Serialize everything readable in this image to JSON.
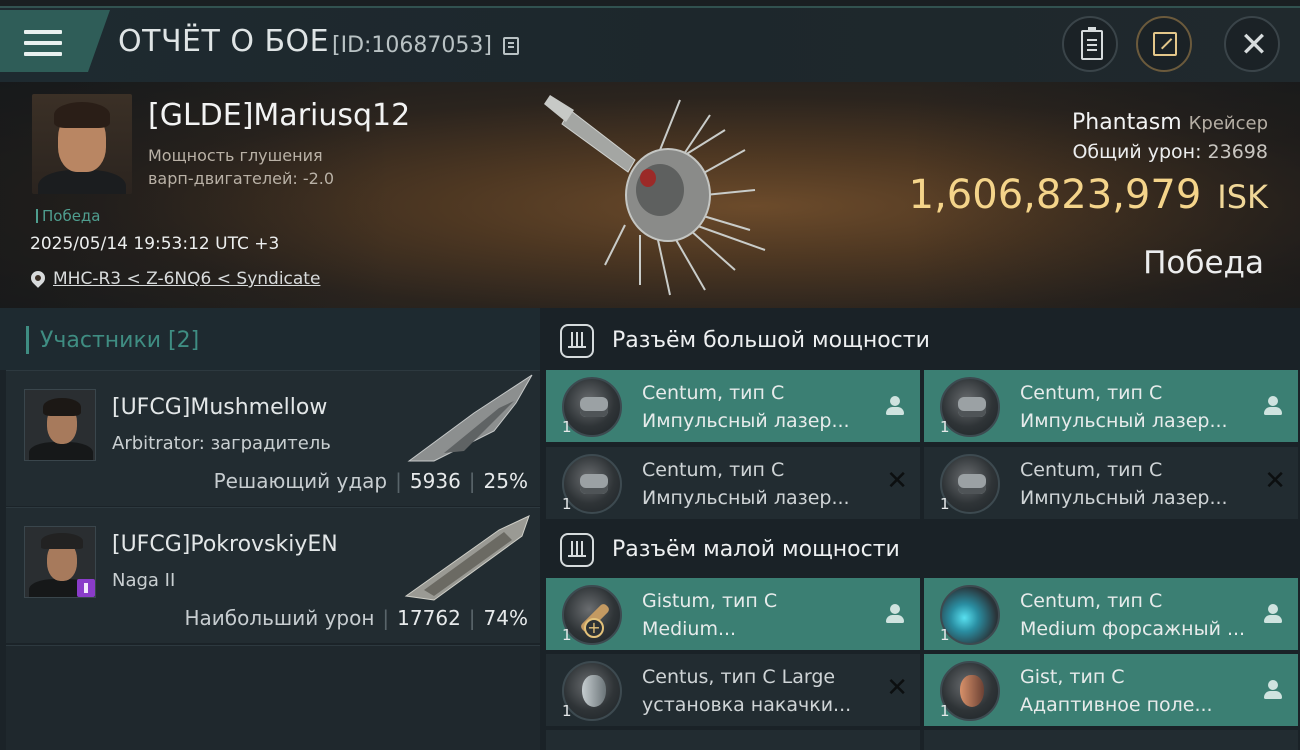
{
  "header": {
    "title": "ОТЧЁТ О БОЕ",
    "battle_id": "[ID:10687053]"
  },
  "victim": {
    "pilot_name": "[GLDE]Mariusq12",
    "warp_label_1": "Мощность глушения",
    "warp_label_2": "варп-двигателей: -2.0",
    "status_small": "Победа",
    "timestamp": "2025/05/14 19:53:12 UTC +3",
    "location": "MHC-R3 < Z-6NQ6 < Syndicate",
    "ship_name": "Phantasm",
    "ship_class": "Крейсер",
    "damage_label": "Общий урон:",
    "damage_value": "23698",
    "isk_value": "1,606,823,979",
    "isk_unit": "ISK",
    "result": "Победа"
  },
  "participants": {
    "title": "Участники [2]",
    "rows": [
      {
        "name": "[UFCG]Mushmellow",
        "ship": "Arbitrator: заградитель",
        "role": "Решающий удар",
        "damage": "5936",
        "percent": "25%"
      },
      {
        "name": "[UFCG]PokrovskiyEN",
        "ship": "Naga II",
        "role": "Наибольший урон",
        "damage": "17762",
        "percent": "74%"
      }
    ]
  },
  "fittings": {
    "high_slot_title": "Разъём большой мощности",
    "low_slot_title": "Разъём малой мощности",
    "high": [
      {
        "qty": "1",
        "line1": "Centum, тип C",
        "line2": "Импульсный лазер...",
        "state": "person"
      },
      {
        "qty": "1",
        "line1": "Centum, тип C",
        "line2": "Импульсный лазер...",
        "state": "person"
      },
      {
        "qty": "1",
        "line1": "Centum, тип C",
        "line2": "Импульсный лазер...",
        "state": "destroyed"
      },
      {
        "qty": "1",
        "line1": "Centum, тип C",
        "line2": "Импульсный лазер...",
        "state": "destroyed"
      }
    ],
    "low": [
      {
        "qty": "1",
        "line1": "Gistum, тип C",
        "line2": "Medium...",
        "state": "person"
      },
      {
        "qty": "1",
        "line1": "Centum, тип C",
        "line2": "Medium форсажный ...",
        "state": "person"
      },
      {
        "qty": "1",
        "line1": "Centus, тип C Large",
        "line2": "установка накачки...",
        "state": "destroyed"
      },
      {
        "qty": "1",
        "line1": "Gist, тип C",
        "line2": "Адаптивное поле...",
        "state": "person"
      }
    ]
  },
  "colors": {
    "accent_teal": "#3b7f73",
    "isk_gold": "#f4d48a",
    "header_bg": "#1e2a30"
  }
}
